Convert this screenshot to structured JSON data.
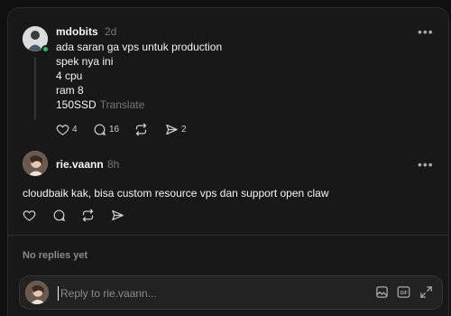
{
  "post": {
    "username": "mdobits",
    "time": "2d",
    "lines": [
      "ada saran ga vps untuk production",
      "spek nya ini",
      "4 cpu",
      "ram 8",
      "150SSD"
    ],
    "translate": "Translate",
    "likes": "4",
    "comments": "16",
    "shares": "2"
  },
  "reply": {
    "username": "rie.vaann",
    "time": "8h",
    "text": "cloudbaik kak, bisa custom resource vps dan support open claw"
  },
  "no_replies": "No replies yet",
  "composer": {
    "placeholder": "Reply to rie.vaann..."
  },
  "icons": {
    "more": "more-horizontal-icon",
    "like": "heart-icon",
    "comment": "comment-icon",
    "repost": "repost-icon",
    "share": "send-icon",
    "image": "image-icon",
    "gif": "gif-icon",
    "expand": "expand-icon"
  },
  "colors": {
    "online": "#1bc160",
    "background": "#181818"
  }
}
